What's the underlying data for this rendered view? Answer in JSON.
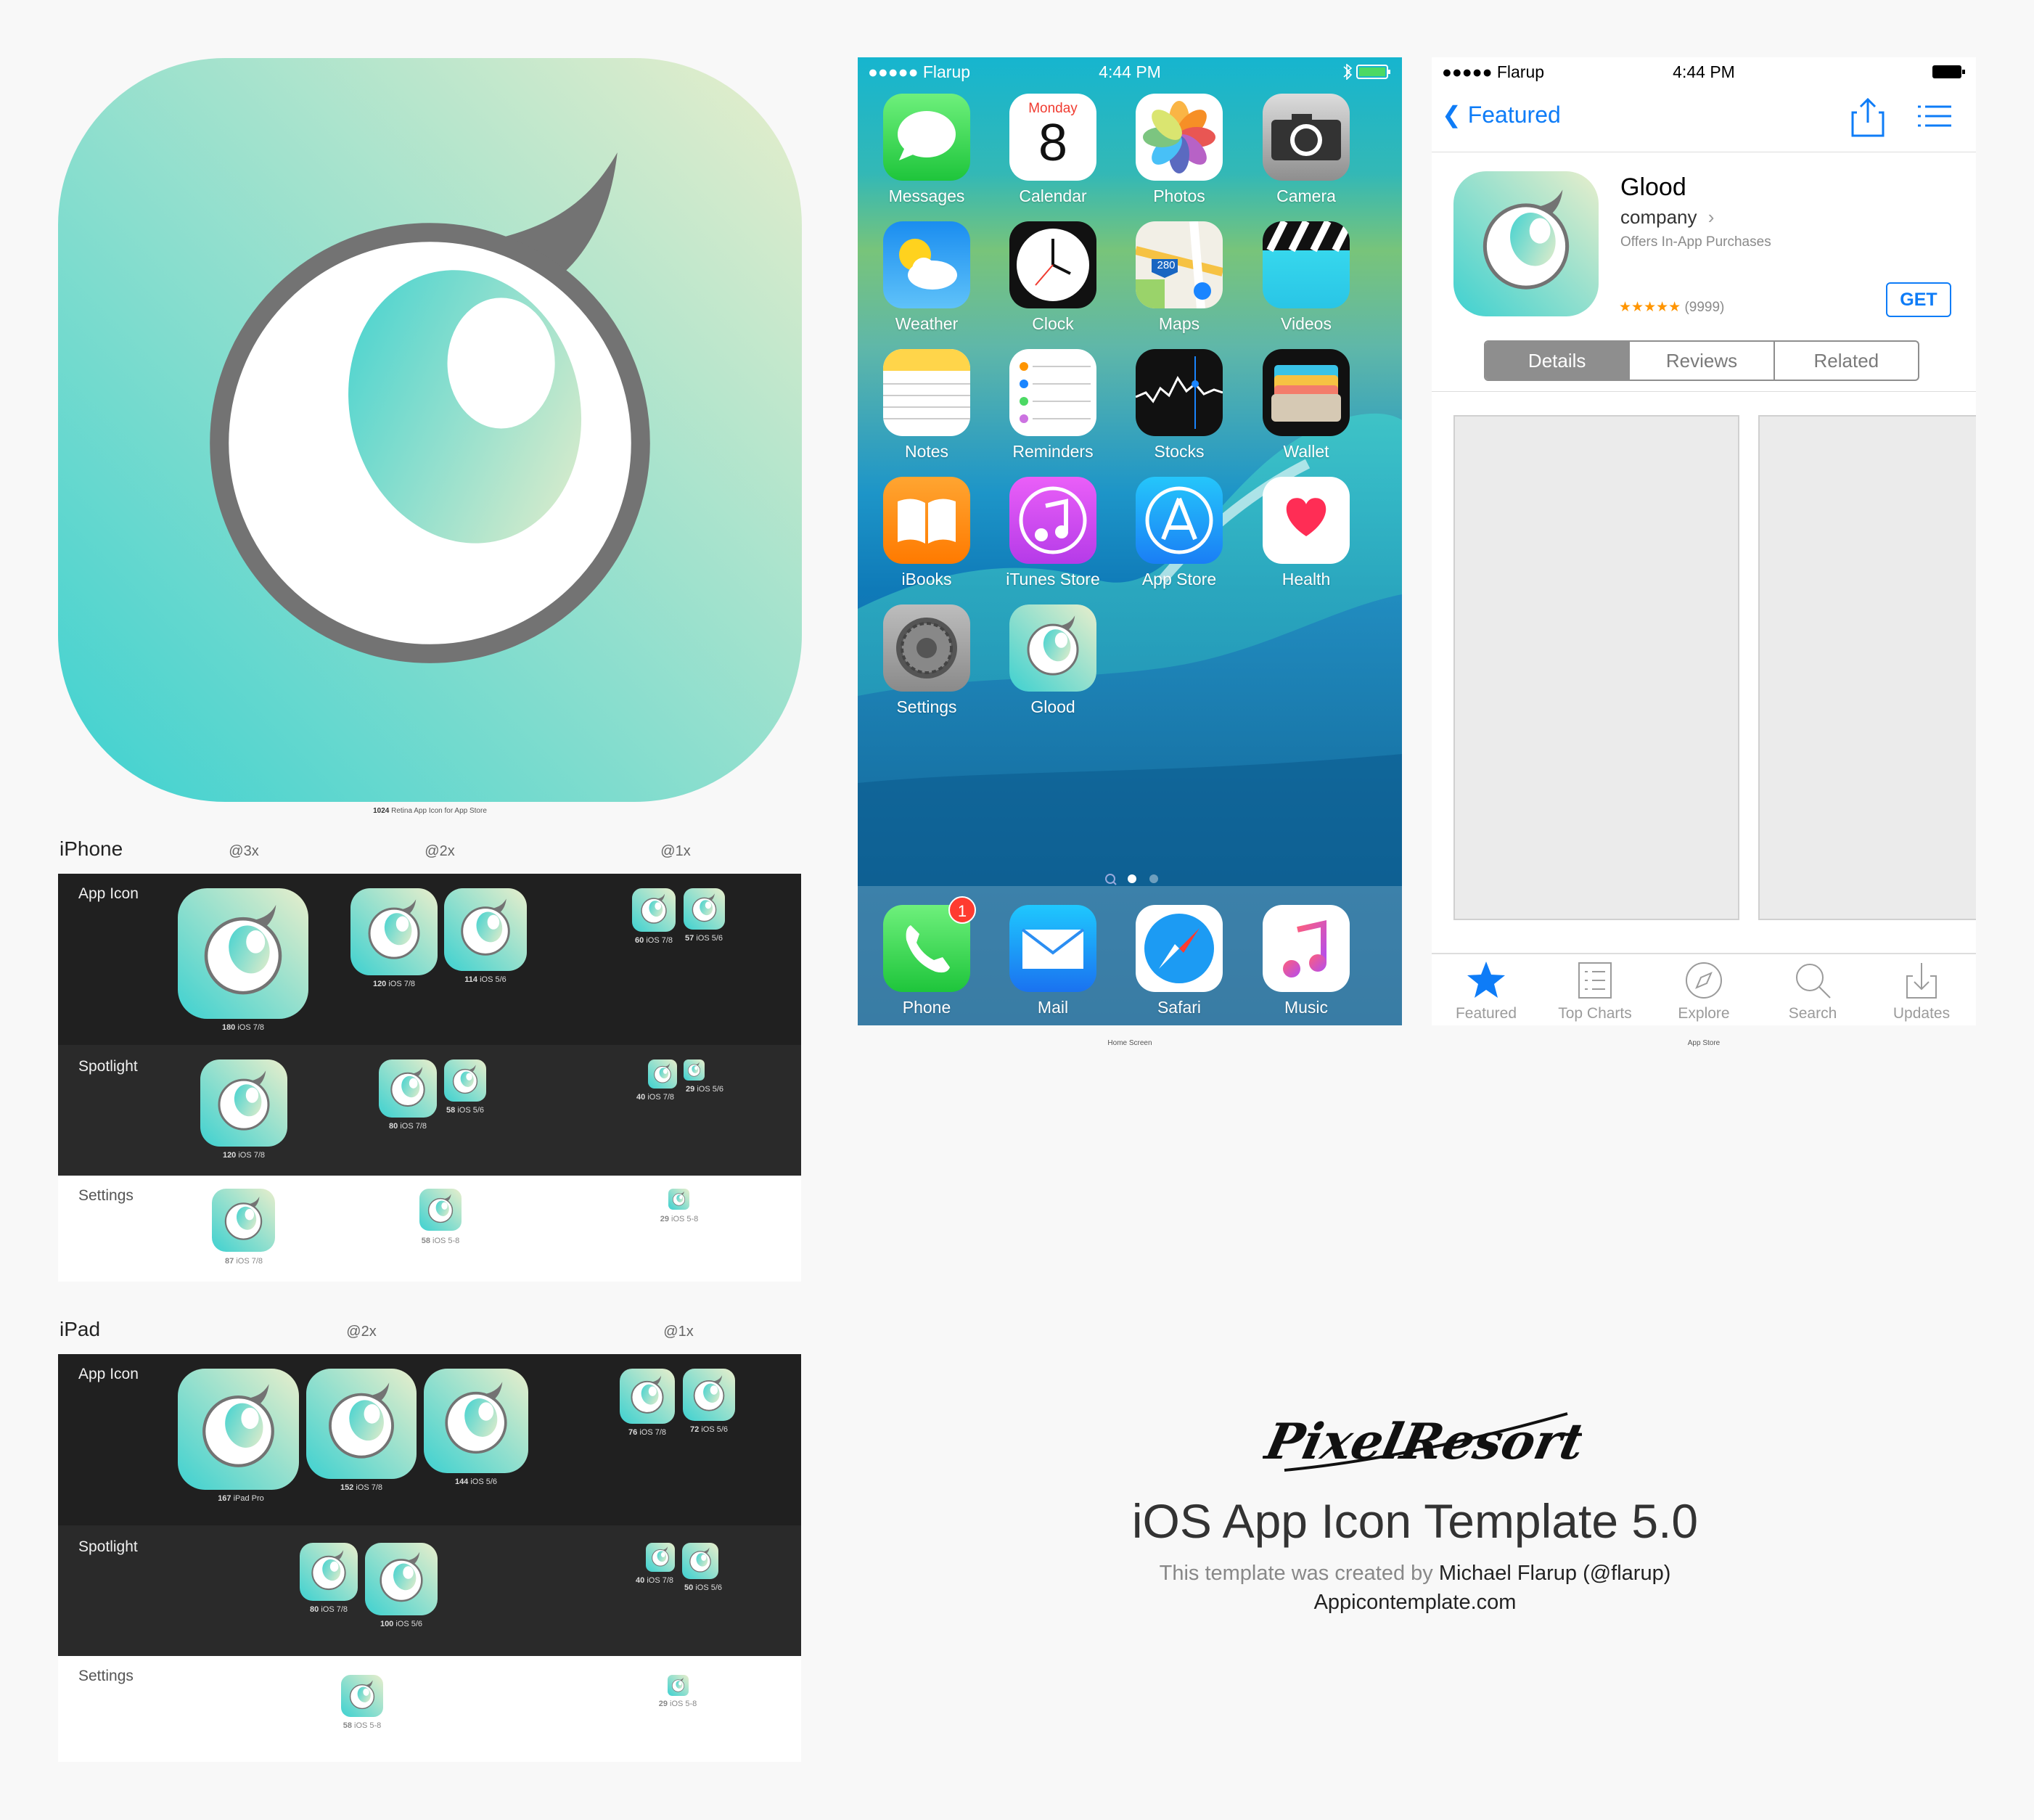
{
  "app_name": "Glood",
  "colors": {
    "icon_top": "#e8eecb",
    "icon_bottom": "#3ed1d0",
    "ring": "#737373",
    "accent_blue": "#0e7cf7",
    "stars": "#ff9500",
    "badge": "#ff3b30"
  },
  "big_icon": {
    "caption_size": "1024",
    "caption_text": "Retina App Icon for App Store"
  },
  "iphone": {
    "title": "iPhone",
    "scales": [
      "@3x",
      "@2x",
      "@1x"
    ],
    "rows": [
      {
        "label": "App Icon",
        "items": [
          {
            "size": "180",
            "ver": "iOS 7/8"
          },
          {
            "size": "120",
            "ver": "iOS 7/8"
          },
          {
            "size": "114",
            "ver": "iOS 5/6"
          },
          {
            "size": "60",
            "ver": "iOS 7/8"
          },
          {
            "size": "57",
            "ver": "iOS 5/6"
          }
        ]
      },
      {
        "label": "Spotlight",
        "items": [
          {
            "size": "120",
            "ver": "iOS 7/8"
          },
          {
            "size": "80",
            "ver": "iOS 7/8"
          },
          {
            "size": "58",
            "ver": "iOS 5/6"
          },
          {
            "size": "40",
            "ver": "iOS 7/8"
          },
          {
            "size": "29",
            "ver": "iOS 5/6"
          }
        ]
      },
      {
        "label": "Settings",
        "items": [
          {
            "size": "87",
            "ver": "iOS 7/8"
          },
          {
            "size": "58",
            "ver": "iOS 5-8"
          },
          {
            "size": "29",
            "ver": "iOS 5-8"
          }
        ]
      }
    ]
  },
  "ipad": {
    "title": "iPad",
    "scales": [
      "@2x",
      "@1x"
    ],
    "rows": [
      {
        "label": "App Icon",
        "items": [
          {
            "size": "167",
            "ver": "iPad Pro"
          },
          {
            "size": "152",
            "ver": "iOS 7/8"
          },
          {
            "size": "144",
            "ver": "iOS 5/6"
          },
          {
            "size": "76",
            "ver": "iOS 7/8"
          },
          {
            "size": "72",
            "ver": "iOS 5/6"
          }
        ]
      },
      {
        "label": "Spotlight",
        "items": [
          {
            "size": "80",
            "ver": "iOS 7/8"
          },
          {
            "size": "100",
            "ver": "iOS 5/6"
          },
          {
            "size": "40",
            "ver": "iOS 7/8"
          },
          {
            "size": "50",
            "ver": "iOS 5/6"
          }
        ]
      },
      {
        "label": "Settings",
        "items": [
          {
            "size": "58",
            "ver": "iOS 5-8"
          },
          {
            "size": "29",
            "ver": "iOS 5-8"
          }
        ]
      }
    ]
  },
  "home_screen": {
    "caption": "Home Screen",
    "status": {
      "carrier": "●●●●● Flarup",
      "time": "4:44 PM"
    },
    "calendar": {
      "day": "Monday",
      "date": "8"
    },
    "maps_sign": "280",
    "apps": [
      "Messages",
      "Calendar",
      "Photos",
      "Camera",
      "Weather",
      "Clock",
      "Maps",
      "Videos",
      "Notes",
      "Reminders",
      "Stocks",
      "Wallet",
      "iBooks",
      "iTunes Store",
      "App Store",
      "Health",
      "Settings",
      "Glood"
    ],
    "dock": [
      "Phone",
      "Mail",
      "Safari",
      "Music"
    ],
    "phone_badge": "1"
  },
  "app_store": {
    "caption": "App Store",
    "status": {
      "carrier": "●●●●● Flarup",
      "time": "4:44 PM"
    },
    "back_label": "Featured",
    "app_title": "Glood",
    "developer": "company",
    "iap_note": "Offers In-App Purchases",
    "stars": "★★★★★",
    "rating_count": "(9999)",
    "get_label": "GET",
    "segments": [
      "Details",
      "Reviews",
      "Related"
    ],
    "tabs": [
      "Featured",
      "Top Charts",
      "Explore",
      "Search",
      "Updates"
    ]
  },
  "branding": {
    "logo": "PixelResort",
    "title": "iOS App Icon Template 5.0",
    "credit_prefix": "This template was created by",
    "credit_name": "Michael Flarup (@flarup)",
    "url": "Appicontemplate.com"
  }
}
